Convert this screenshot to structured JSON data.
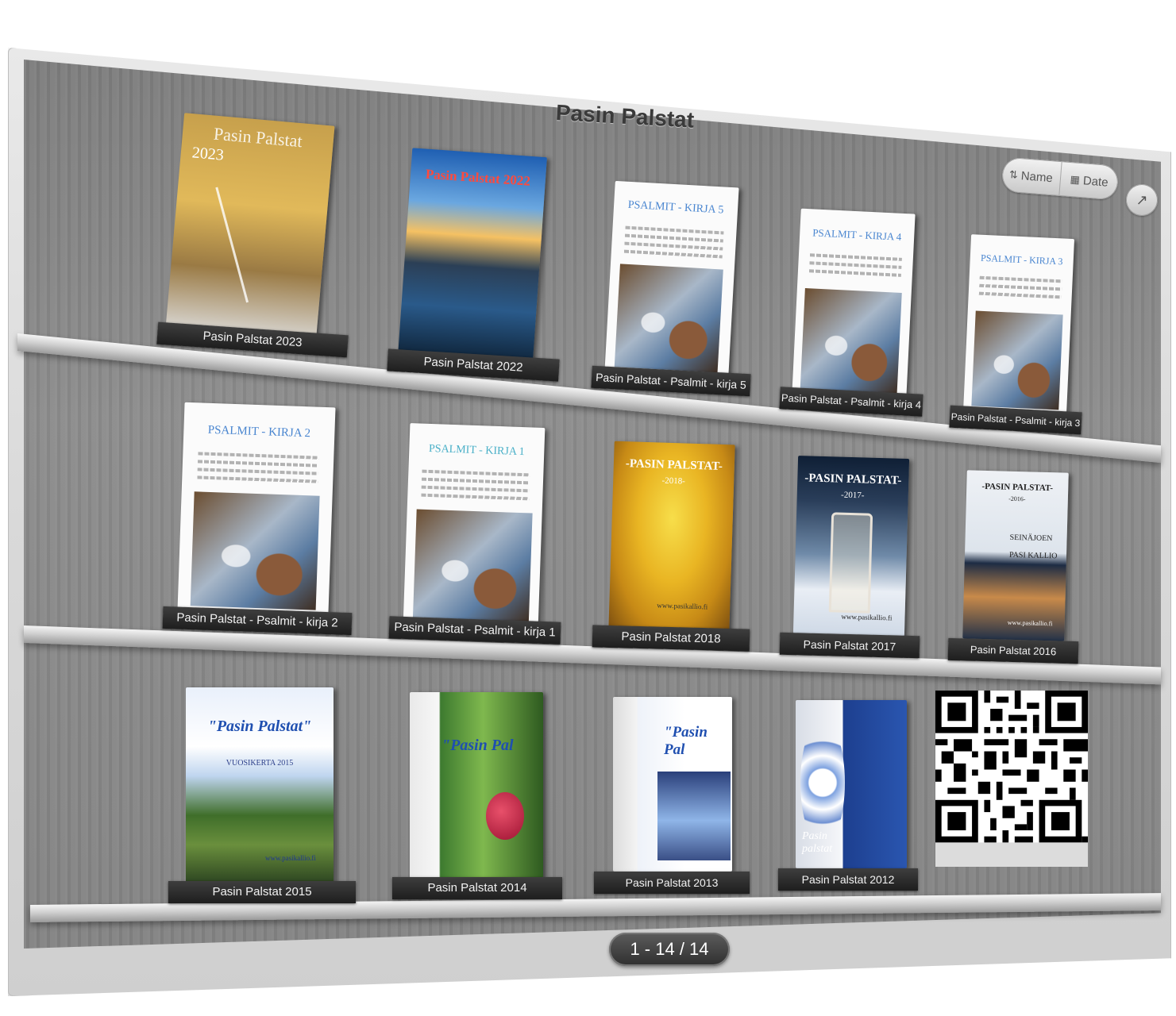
{
  "app": {
    "title": "Pasin Palstat"
  },
  "sort": {
    "name_label": "Name",
    "date_label": "Date"
  },
  "pager": {
    "text": "1 - 14 / 14"
  },
  "books": [
    {
      "label": "Pasin Palstat 2023",
      "cover_title": "Pasin Palstat",
      "cover_sub": "2023"
    },
    {
      "label": "Pasin Palstat 2022",
      "cover_title": "Pasin Palstat 2022"
    },
    {
      "label": "Pasin Palstat - Psalmit - kirja 5",
      "cover_title": "PSALMIT - KIRJA 5"
    },
    {
      "label": "Pasin Palstat - Psalmit - kirja 4",
      "cover_title": "PSALMIT - KIRJA 4"
    },
    {
      "label": "Pasin Palstat - Psalmit - kirja 3",
      "cover_title": "PSALMIT - KIRJA 3"
    },
    {
      "label": "Pasin Palstat - Psalmit - kirja 2",
      "cover_title": "PSALMIT - KIRJA 2"
    },
    {
      "label": "Pasin Palstat - Psalmit - kirja 1",
      "cover_title": "PSALMIT - KIRJA 1"
    },
    {
      "label": "Pasin Palstat 2018",
      "cover_title": "-PASIN PALSTAT-",
      "cover_sub": "-2018-"
    },
    {
      "label": "Pasin Palstat 2017",
      "cover_title": "-PASIN PALSTAT-",
      "cover_sub": "-2017-"
    },
    {
      "label": "Pasin Palstat 2016",
      "cover_title": "-PASIN PALSTAT-",
      "cover_sub": "-2016-",
      "cover_extra": "SEINÄJOEN",
      "cover_author": "PASI KALLIO"
    },
    {
      "label": "Pasin Palstat 2015",
      "cover_title": "\"Pasin Palstat\"",
      "cover_sub": "VUOSIKERTA 2015"
    },
    {
      "label": "Pasin Palstat 2014",
      "cover_title": "\"Pasin Pal"
    },
    {
      "label": "Pasin Palstat 2013",
      "cover_title": "\"Pasin Pal"
    },
    {
      "label": "Pasin Palstat 2012",
      "cover_title": "Pasin palstat"
    }
  ],
  "website": "www.pasikallio.fi",
  "colors": {
    "shelf_wall": "#858585",
    "label_bg": "#2a2a2a",
    "label_text": "#f2f2f2"
  },
  "icons": {
    "sort_name": "sort-alpha-icon",
    "sort_date": "calendar-icon",
    "share": "share-icon"
  }
}
